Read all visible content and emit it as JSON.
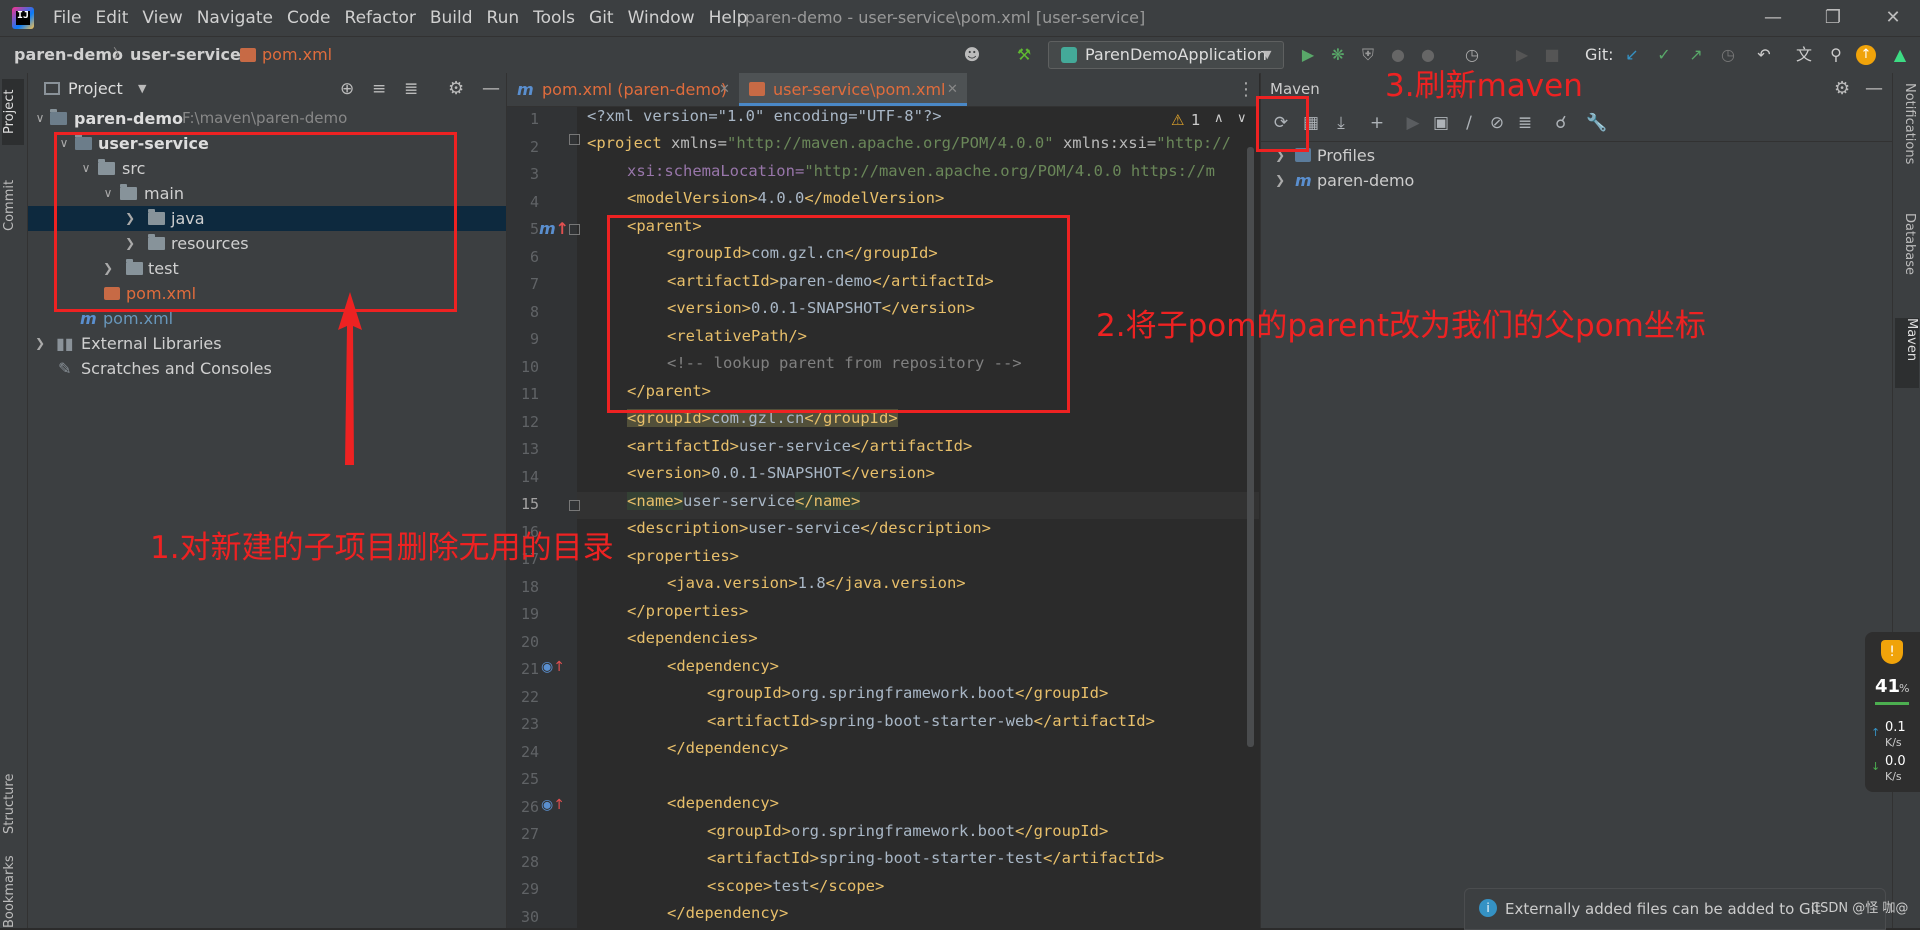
{
  "menubar": {
    "items": [
      "File",
      "Edit",
      "View",
      "Navigate",
      "Code",
      "Refactor",
      "Build",
      "Run",
      "Tools",
      "Git",
      "Window",
      "Help"
    ],
    "title": "paren-demo - user-service\\pom.xml [user-service]"
  },
  "navbar": {
    "crumbs": [
      "paren-demo",
      "user-service",
      "pom.xml"
    ],
    "run_config": "ParenDemoApplication",
    "git_label": "Git:"
  },
  "left_strip": {
    "tabs": [
      "Project",
      "Commit",
      "Structure",
      "Bookmarks"
    ]
  },
  "project": {
    "header": "Project",
    "root_name": "paren-demo",
    "root_path": "F:\\maven\\paren-demo",
    "tree": [
      "user-service",
      "src",
      "main",
      "java",
      "resources",
      "test",
      "pom.xml",
      "pom.xml",
      "External Libraries",
      "Scratches and Consoles"
    ]
  },
  "editor": {
    "tabs": [
      "pom.xml (paren-demo)",
      "user-service\\pom.xml"
    ],
    "warnings": "1",
    "line_numbers": [
      "1",
      "2",
      "3",
      "4",
      "5",
      "6",
      "7",
      "8",
      "9",
      "10",
      "11",
      "12",
      "13",
      "14",
      "15",
      "16",
      "17",
      "18",
      "19",
      "20",
      "21",
      "22",
      "23",
      "24",
      "25",
      "26",
      "27",
      "28",
      "29",
      "30"
    ]
  },
  "code": {
    "l1": "<?xml version=\"1.0\" encoding=\"UTF-8\"?>",
    "l2_tag": "<project",
    "l2_attr": " xmlns=",
    "l2_val": "\"http://maven.apache.org/POM/4.0.0\"",
    "l2_attr2": " xmlns:xsi=",
    "l2_val2": "\"http://",
    "l3_attr": "xsi:schemaLocation=",
    "l3_val": "\"http://maven.apache.org/POM/4.0.0 https://m",
    "model_open": "<modelVersion>",
    "model_val": "4.0.0",
    "model_close": "</modelVersion>",
    "parent_open": "<parent>",
    "g_open": "<groupId>",
    "g_val": "com.gzl.cn",
    "g_close": "</groupId>",
    "a_open": "<artifactId>",
    "a_val": "paren-demo",
    "a_close": "</artifactId>",
    "v_open": "<version>",
    "v_val": "0.0.1-SNAPSHOT",
    "v_close": "</version>",
    "rel": "<relativePath/>",
    "comment": "<!-- lookup parent from repository -->",
    "parent_close": "</parent>",
    "g2_val": "com.gzl.cn",
    "a2_val": "user-service",
    "v2_val": "0.0.1-SNAPSHOT",
    "n_open": "<name>",
    "n_val": "user-service",
    "n_close": "</name>",
    "d_open": "<description>",
    "d_val": "user-service",
    "d_close": "</description>",
    "props_open": "<properties>",
    "jv_open": "<java.version>",
    "jv_val": "1.8",
    "jv_close": "</java.version>",
    "props_close": "</properties>",
    "deps_open": "<dependencies>",
    "dep_open": "<dependency>",
    "sb_group": "org.springframework.boot",
    "web": "spring-boot-starter-web",
    "dep_close": "</dependency>",
    "test_art": "spring-boot-starter-test",
    "scope_open": "<scope>",
    "scope_val": "test",
    "scope_close": "</scope>"
  },
  "maven": {
    "title": "Maven",
    "items": [
      "Profiles",
      "paren-demo"
    ]
  },
  "annotations": {
    "a1": "1.对新建的子项目删除无用的目录",
    "a2": "2.将子pom的parent改为我们的父pom坐标",
    "a3": "3.刷新maven"
  },
  "widget": {
    "percent": "41",
    "unit": "%",
    "up": "0.1",
    "down": "0.0",
    "rate_unit": "K/s"
  },
  "notification": {
    "text": "Externally added files can be added to Git",
    "watermark": "CSDN @怪 咖@"
  },
  "right_strip": {
    "tabs": [
      "Notifications",
      "Database",
      "Maven"
    ]
  }
}
